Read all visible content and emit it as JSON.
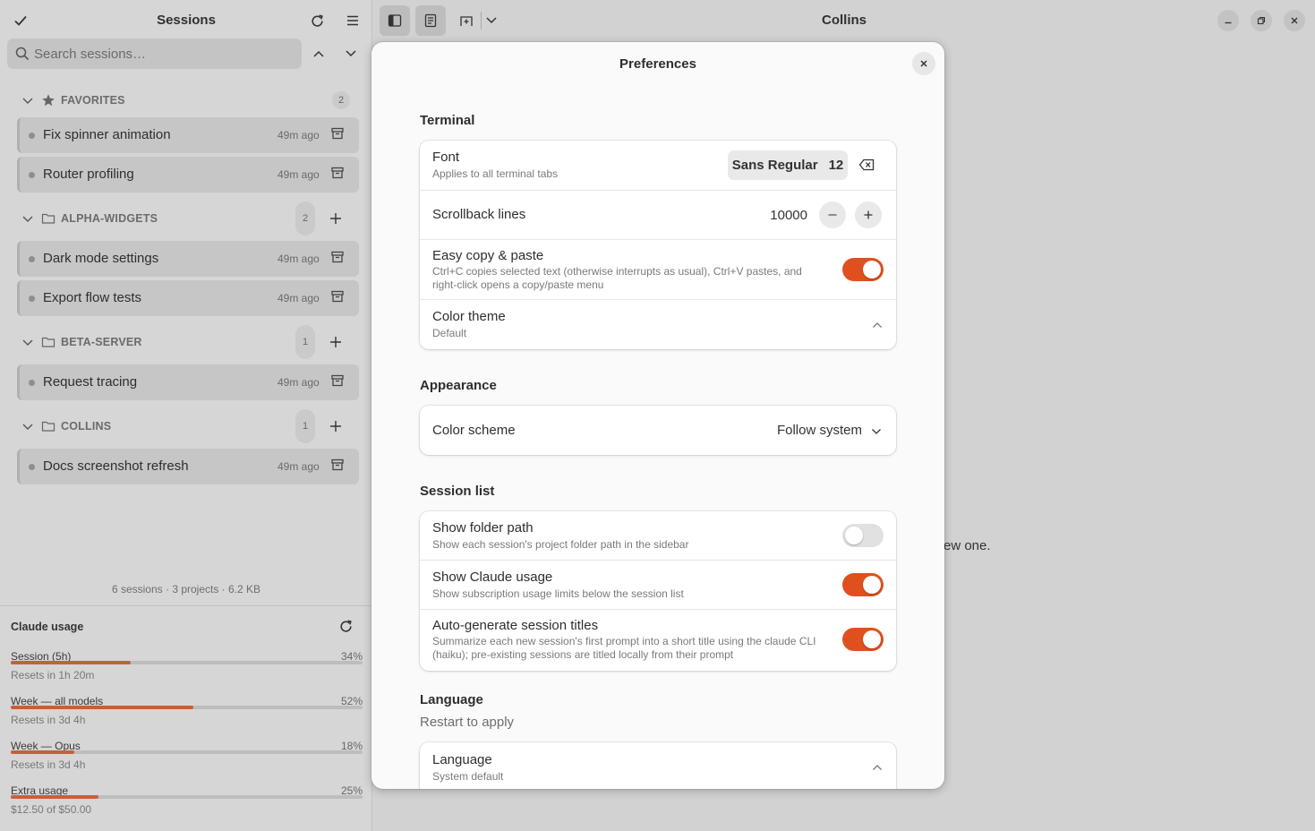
{
  "sidebar": {
    "title": "Sessions",
    "search_placeholder": "Search sessions…",
    "groups": [
      {
        "label": "FAVORITES",
        "count": "2",
        "icon": "star-icon",
        "items": [
          {
            "title": "Fix spinner animation",
            "time": "49m ago"
          },
          {
            "title": "Router profiling",
            "time": "49m ago"
          }
        ]
      },
      {
        "label": "ALPHA-WIDGETS",
        "count": "2",
        "icon": "folder-icon",
        "items": [
          {
            "title": "Dark mode settings",
            "time": "49m ago"
          },
          {
            "title": "Export flow tests",
            "time": "49m ago"
          }
        ]
      },
      {
        "label": "BETA-SERVER",
        "count": "1",
        "icon": "folder-icon",
        "items": [
          {
            "title": "Request tracing",
            "time": "49m ago"
          }
        ]
      },
      {
        "label": "COLLINS",
        "count": "1",
        "icon": "folder-icon",
        "items": [
          {
            "title": "Docs screenshot refresh",
            "time": "49m ago"
          }
        ]
      }
    ],
    "stats": "6 sessions · 3 projects · 6.2 KB",
    "usage": {
      "title": "Claude usage",
      "metrics": [
        {
          "label": "Session (5h)",
          "percent": "34%",
          "fraction": 0.34,
          "note": "Resets in 1h 20m"
        },
        {
          "label": "Week — all models",
          "percent": "52%",
          "fraction": 0.52,
          "note": "Resets in 3d 4h"
        },
        {
          "label": "Week — Opus",
          "percent": "18%",
          "fraction": 0.18,
          "note": "Resets in 3d 4h"
        },
        {
          "label": "Extra usage",
          "percent": "25%",
          "fraction": 0.25,
          "note": "$12.50 of $50.00"
        }
      ]
    }
  },
  "main": {
    "window_title": "Collins",
    "background_hint": "ew one."
  },
  "preferences": {
    "title": "Preferences",
    "terminal": {
      "heading": "Terminal",
      "font_title": "Font",
      "font_subtitle": "Applies to all terminal tabs",
      "font_name": "Sans Regular",
      "font_size": "12",
      "scrollback_title": "Scrollback lines",
      "scrollback_value": "10000",
      "copy_title": "Easy copy & paste",
      "copy_subtitle": "Ctrl+C copies selected text (otherwise interrupts as usual), Ctrl+V pastes, and right-click opens a copy/paste menu",
      "copy_enabled": true,
      "theme_title": "Color theme",
      "theme_value": "Default"
    },
    "appearance": {
      "heading": "Appearance",
      "scheme_title": "Color scheme",
      "scheme_value": "Follow system"
    },
    "session_list": {
      "heading": "Session list",
      "folder_title": "Show folder path",
      "folder_subtitle": "Show each session's project folder path in the sidebar",
      "folder_enabled": false,
      "usage_title": "Show Claude usage",
      "usage_subtitle": "Show subscription usage limits below the session list",
      "usage_enabled": true,
      "autotitle_title": "Auto-generate session titles",
      "autotitle_subtitle": "Summarize each new session's first prompt into a short title using the claude CLI (haiku); pre-existing sessions are titled locally from their prompt",
      "autotitle_enabled": true
    },
    "language": {
      "heading": "Language",
      "subheading": "Restart to apply",
      "lang_title": "Language",
      "lang_value": "System default"
    }
  },
  "colors": {
    "accent": "#e0501f",
    "usage_bar": "#c4603f"
  }
}
